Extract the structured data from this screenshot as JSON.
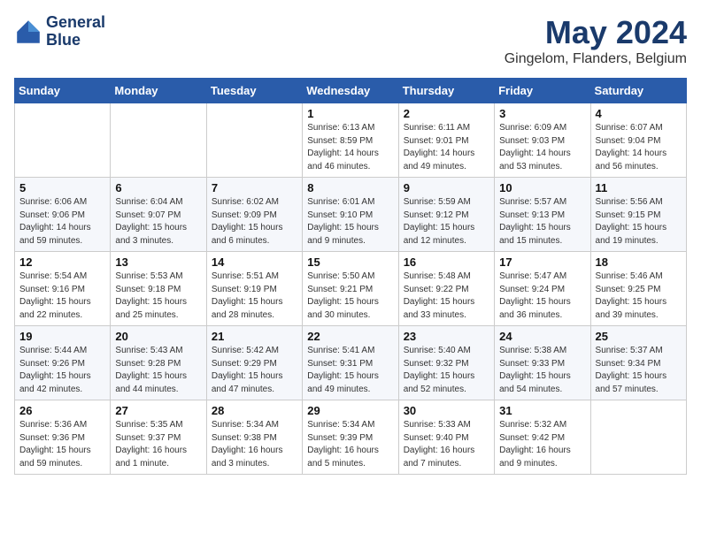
{
  "header": {
    "logo_line1": "General",
    "logo_line2": "Blue",
    "month": "May 2024",
    "location": "Gingelom, Flanders, Belgium"
  },
  "days_of_week": [
    "Sunday",
    "Monday",
    "Tuesday",
    "Wednesday",
    "Thursday",
    "Friday",
    "Saturday"
  ],
  "weeks": [
    [
      {
        "day": "",
        "detail": ""
      },
      {
        "day": "",
        "detail": ""
      },
      {
        "day": "",
        "detail": ""
      },
      {
        "day": "1",
        "detail": "Sunrise: 6:13 AM\nSunset: 8:59 PM\nDaylight: 14 hours\nand 46 minutes."
      },
      {
        "day": "2",
        "detail": "Sunrise: 6:11 AM\nSunset: 9:01 PM\nDaylight: 14 hours\nand 49 minutes."
      },
      {
        "day": "3",
        "detail": "Sunrise: 6:09 AM\nSunset: 9:03 PM\nDaylight: 14 hours\nand 53 minutes."
      },
      {
        "day": "4",
        "detail": "Sunrise: 6:07 AM\nSunset: 9:04 PM\nDaylight: 14 hours\nand 56 minutes."
      }
    ],
    [
      {
        "day": "5",
        "detail": "Sunrise: 6:06 AM\nSunset: 9:06 PM\nDaylight: 14 hours\nand 59 minutes."
      },
      {
        "day": "6",
        "detail": "Sunrise: 6:04 AM\nSunset: 9:07 PM\nDaylight: 15 hours\nand 3 minutes."
      },
      {
        "day": "7",
        "detail": "Sunrise: 6:02 AM\nSunset: 9:09 PM\nDaylight: 15 hours\nand 6 minutes."
      },
      {
        "day": "8",
        "detail": "Sunrise: 6:01 AM\nSunset: 9:10 PM\nDaylight: 15 hours\nand 9 minutes."
      },
      {
        "day": "9",
        "detail": "Sunrise: 5:59 AM\nSunset: 9:12 PM\nDaylight: 15 hours\nand 12 minutes."
      },
      {
        "day": "10",
        "detail": "Sunrise: 5:57 AM\nSunset: 9:13 PM\nDaylight: 15 hours\nand 15 minutes."
      },
      {
        "day": "11",
        "detail": "Sunrise: 5:56 AM\nSunset: 9:15 PM\nDaylight: 15 hours\nand 19 minutes."
      }
    ],
    [
      {
        "day": "12",
        "detail": "Sunrise: 5:54 AM\nSunset: 9:16 PM\nDaylight: 15 hours\nand 22 minutes."
      },
      {
        "day": "13",
        "detail": "Sunrise: 5:53 AM\nSunset: 9:18 PM\nDaylight: 15 hours\nand 25 minutes."
      },
      {
        "day": "14",
        "detail": "Sunrise: 5:51 AM\nSunset: 9:19 PM\nDaylight: 15 hours\nand 28 minutes."
      },
      {
        "day": "15",
        "detail": "Sunrise: 5:50 AM\nSunset: 9:21 PM\nDaylight: 15 hours\nand 30 minutes."
      },
      {
        "day": "16",
        "detail": "Sunrise: 5:48 AM\nSunset: 9:22 PM\nDaylight: 15 hours\nand 33 minutes."
      },
      {
        "day": "17",
        "detail": "Sunrise: 5:47 AM\nSunset: 9:24 PM\nDaylight: 15 hours\nand 36 minutes."
      },
      {
        "day": "18",
        "detail": "Sunrise: 5:46 AM\nSunset: 9:25 PM\nDaylight: 15 hours\nand 39 minutes."
      }
    ],
    [
      {
        "day": "19",
        "detail": "Sunrise: 5:44 AM\nSunset: 9:26 PM\nDaylight: 15 hours\nand 42 minutes."
      },
      {
        "day": "20",
        "detail": "Sunrise: 5:43 AM\nSunset: 9:28 PM\nDaylight: 15 hours\nand 44 minutes."
      },
      {
        "day": "21",
        "detail": "Sunrise: 5:42 AM\nSunset: 9:29 PM\nDaylight: 15 hours\nand 47 minutes."
      },
      {
        "day": "22",
        "detail": "Sunrise: 5:41 AM\nSunset: 9:31 PM\nDaylight: 15 hours\nand 49 minutes."
      },
      {
        "day": "23",
        "detail": "Sunrise: 5:40 AM\nSunset: 9:32 PM\nDaylight: 15 hours\nand 52 minutes."
      },
      {
        "day": "24",
        "detail": "Sunrise: 5:38 AM\nSunset: 9:33 PM\nDaylight: 15 hours\nand 54 minutes."
      },
      {
        "day": "25",
        "detail": "Sunrise: 5:37 AM\nSunset: 9:34 PM\nDaylight: 15 hours\nand 57 minutes."
      }
    ],
    [
      {
        "day": "26",
        "detail": "Sunrise: 5:36 AM\nSunset: 9:36 PM\nDaylight: 15 hours\nand 59 minutes."
      },
      {
        "day": "27",
        "detail": "Sunrise: 5:35 AM\nSunset: 9:37 PM\nDaylight: 16 hours\nand 1 minute."
      },
      {
        "day": "28",
        "detail": "Sunrise: 5:34 AM\nSunset: 9:38 PM\nDaylight: 16 hours\nand 3 minutes."
      },
      {
        "day": "29",
        "detail": "Sunrise: 5:34 AM\nSunset: 9:39 PM\nDaylight: 16 hours\nand 5 minutes."
      },
      {
        "day": "30",
        "detail": "Sunrise: 5:33 AM\nSunset: 9:40 PM\nDaylight: 16 hours\nand 7 minutes."
      },
      {
        "day": "31",
        "detail": "Sunrise: 5:32 AM\nSunset: 9:42 PM\nDaylight: 16 hours\nand 9 minutes."
      },
      {
        "day": "",
        "detail": ""
      }
    ]
  ]
}
